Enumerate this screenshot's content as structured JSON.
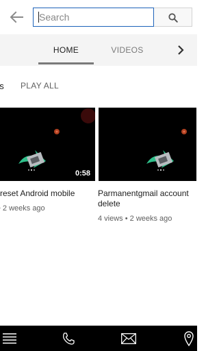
{
  "search": {
    "placeholder": "Search",
    "value": ""
  },
  "tabs": [
    {
      "label": "HOME",
      "selected": true
    },
    {
      "label": "VIDEOS",
      "selected": false
    }
  ],
  "section": {
    "title": "ds",
    "play_all_label": "PLAY ALL"
  },
  "videos": [
    {
      "title": "reset Android mobile",
      "meta": "• 2 weeks ago",
      "duration": "0:58"
    },
    {
      "title": "Parmanentgmail account delete",
      "meta": "4 views • 2 weeks ago",
      "duration": ""
    }
  ],
  "bottom_nav": [
    {
      "icon": "menu-icon"
    },
    {
      "icon": "phone-icon"
    },
    {
      "icon": "mail-icon"
    },
    {
      "icon": "location-pin-icon"
    }
  ],
  "colors": {
    "accent": "#1c62b9",
    "tab_indicator": "#7a7a7a",
    "tab_bar_bg": "#f4f4f4",
    "nav_bg": "#000000",
    "thumb_green": "#2fbf8a"
  }
}
